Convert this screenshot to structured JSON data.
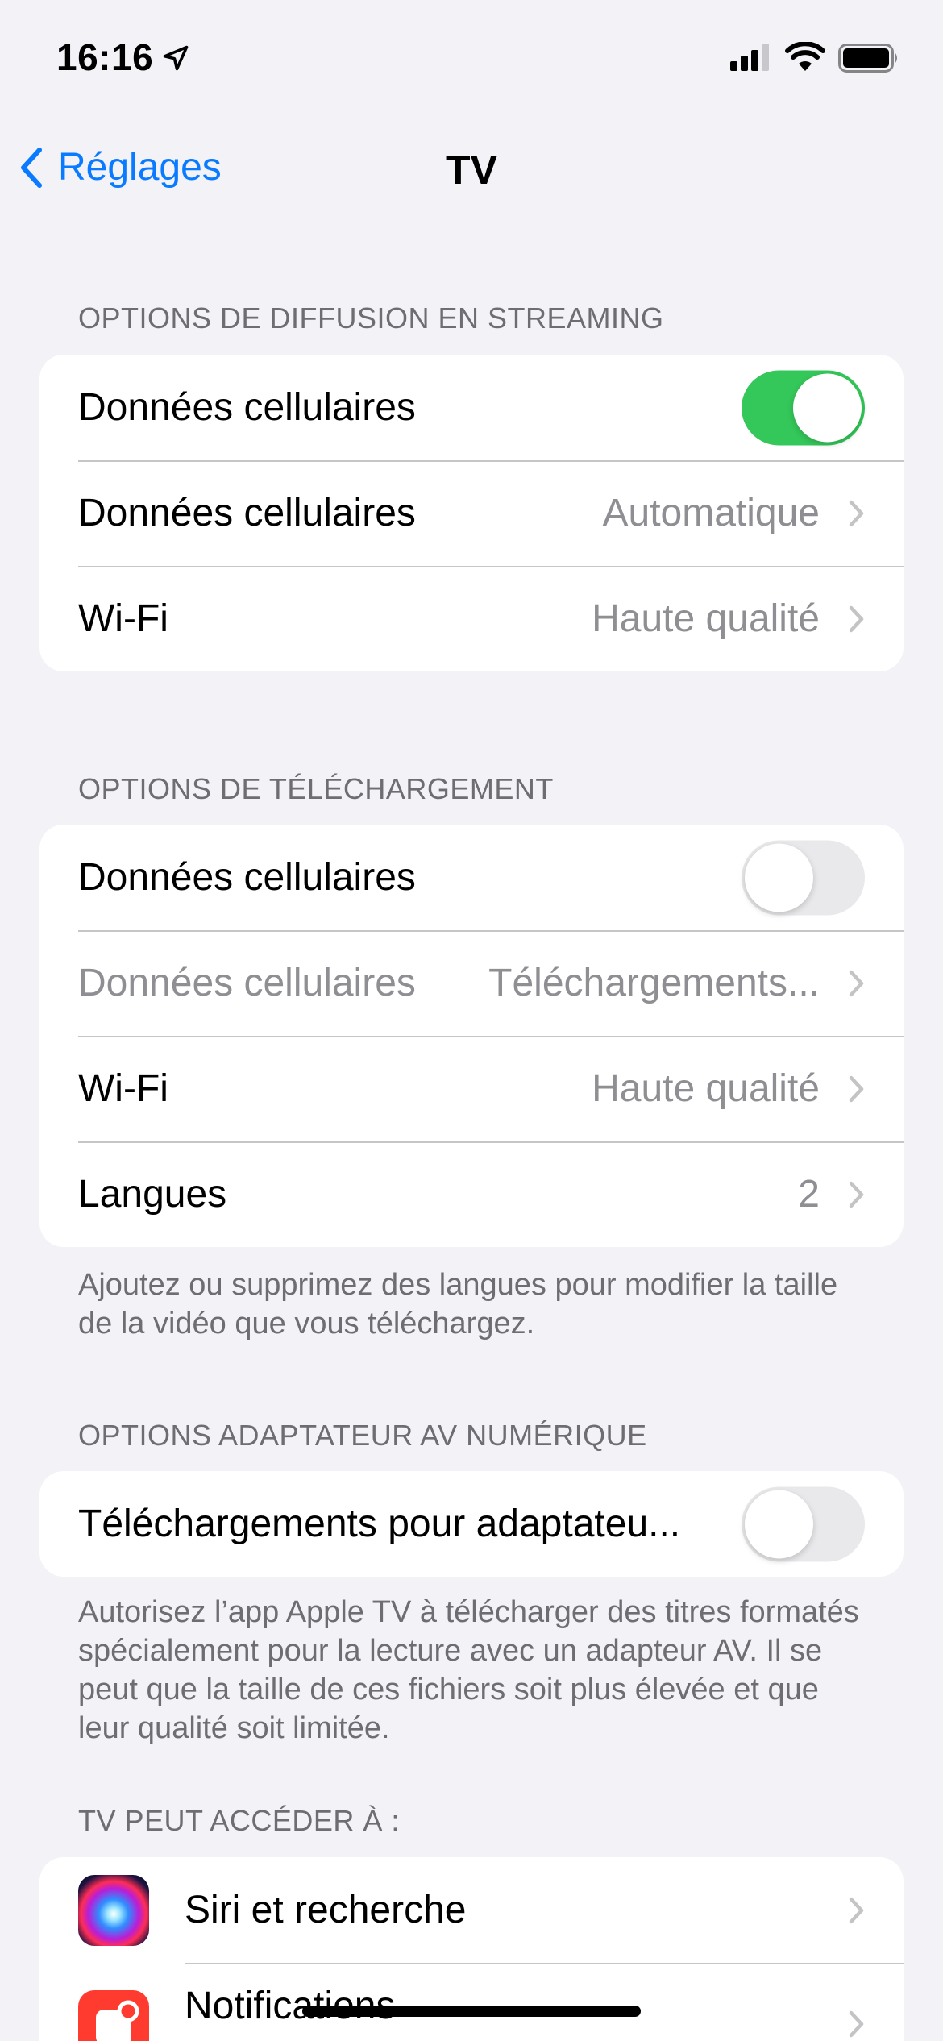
{
  "status_bar": {
    "time": "16:16"
  },
  "nav": {
    "back_label": "Réglages",
    "title": "TV"
  },
  "streaming": {
    "header": "OPTIONS DE DIFFUSION EN STREAMING",
    "rows": [
      {
        "label": "Données cellulaires",
        "toggle": true
      },
      {
        "label": "Données cellulaires",
        "value": "Automatique"
      },
      {
        "label": "Wi-Fi",
        "value": "Haute qualité"
      }
    ]
  },
  "download": {
    "header": "OPTIONS DE TÉLÉCHARGEMENT",
    "rows": [
      {
        "label": "Données cellulaires",
        "toggle": false
      },
      {
        "label": "Données cellulaires",
        "value": "Téléchargements..."
      },
      {
        "label": "Wi-Fi",
        "value": "Haute qualité"
      },
      {
        "label": "Langues",
        "value": "2"
      }
    ],
    "footer": "Ajoutez ou supprimez des langues pour modifier la taille de la vidéo que vous téléchargez."
  },
  "av_adapter": {
    "header": "OPTIONS ADAPTATEUR AV NUMÉRIQUE",
    "rows": [
      {
        "label": "Téléchargements pour adaptateu...",
        "toggle": false
      }
    ],
    "footer": "Autorisez l’app Apple TV à télécharger des titres formatés spécialement pour la lecture avec un adapteur AV. Il se peut que la taille de ces fichiers soit plus élevée et que leur qualité soit limitée."
  },
  "access": {
    "header": "TV PEUT ACCÉDER À :",
    "rows": [
      {
        "label": "Siri et recherche",
        "icon": "siri-icon"
      },
      {
        "label": "Notifications",
        "icon": "notifications-icon"
      }
    ]
  },
  "colors": {
    "accent": "#0a7aff",
    "toggle_on": "#34c759",
    "background": "#f2f2f7"
  }
}
